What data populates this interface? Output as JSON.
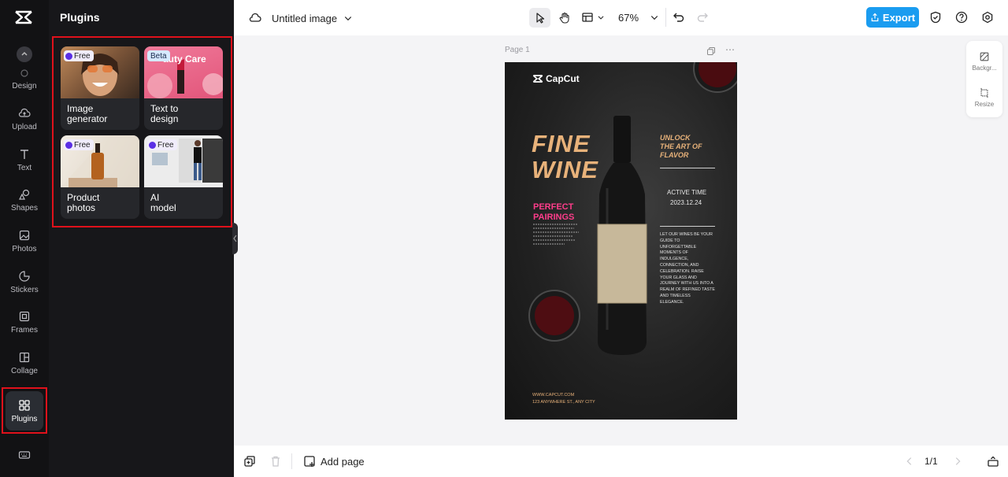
{
  "rail": {
    "items": [
      {
        "id": "design",
        "label": "Design",
        "icon": "design-icon"
      },
      {
        "id": "upload",
        "label": "Upload",
        "icon": "upload-icon"
      },
      {
        "id": "text",
        "label": "Text",
        "icon": "text-icon"
      },
      {
        "id": "shapes",
        "label": "Shapes",
        "icon": "shapes-icon"
      },
      {
        "id": "photos",
        "label": "Photos",
        "icon": "photos-icon"
      },
      {
        "id": "stickers",
        "label": "Stickers",
        "icon": "stickers-icon"
      },
      {
        "id": "frames",
        "label": "Frames",
        "icon": "frames-icon"
      },
      {
        "id": "collage",
        "label": "Collage",
        "icon": "collage-icon"
      },
      {
        "id": "plugins",
        "label": "Plugins",
        "icon": "plugins-icon",
        "active": true
      }
    ]
  },
  "panel": {
    "title": "Plugins",
    "cards": [
      {
        "label": "Image generator",
        "label_lines": [
          "Image",
          "generator"
        ],
        "badge": "Free"
      },
      {
        "label": "Text to design",
        "label_lines": [
          "Text to",
          "design"
        ],
        "badge": "Beta",
        "thumb_text": "auty Care"
      },
      {
        "label": "Product photos",
        "label_lines": [
          "Product",
          "photos"
        ],
        "badge": "Free"
      },
      {
        "label": "AI model",
        "label_lines": [
          "AI",
          "model"
        ],
        "badge": "Free"
      }
    ]
  },
  "topbar": {
    "doc_title": "Untitled image",
    "zoom": "67%",
    "export_label": "Export"
  },
  "canvas": {
    "page_label": "Page 1",
    "poster": {
      "brand": "CapCut",
      "headline_1": "FINE",
      "headline_2": "WINE",
      "tagline_1": "UNLOCK",
      "tagline_2": "THE ART OF",
      "tagline_3": "FLAVOR",
      "active_time_label": "ACTIVE TIME",
      "active_time_date": "2023.12.24",
      "pairings_1": "PERFECT",
      "pairings_2": "PAIRINGS",
      "body_text": "LET OUR WINES BE YOUR GUIDE TO UNFORGETTABLE MOMENTS OF INDULGENCE, CONNECTION, AND CELEBRATION. RAISE YOUR GLASS AND JOURNEY WITH US INTO A REALM OF REFINED TASTE AND TIMELESS ELEGANCE.",
      "website": "WWW.CAPCUT.COM",
      "address": "123 ANYWHERE ST., ANY CITY"
    }
  },
  "side_tools": {
    "background_label": "Backgr...",
    "resize_label": "Resize"
  },
  "bottombar": {
    "add_page_label": "Add page",
    "page_counter": "1/1"
  },
  "colors": {
    "accent": "#1a9cf0",
    "highlight": "#e0111b",
    "wine_gold": "#e8b27a",
    "pink": "#ff3d8b"
  }
}
